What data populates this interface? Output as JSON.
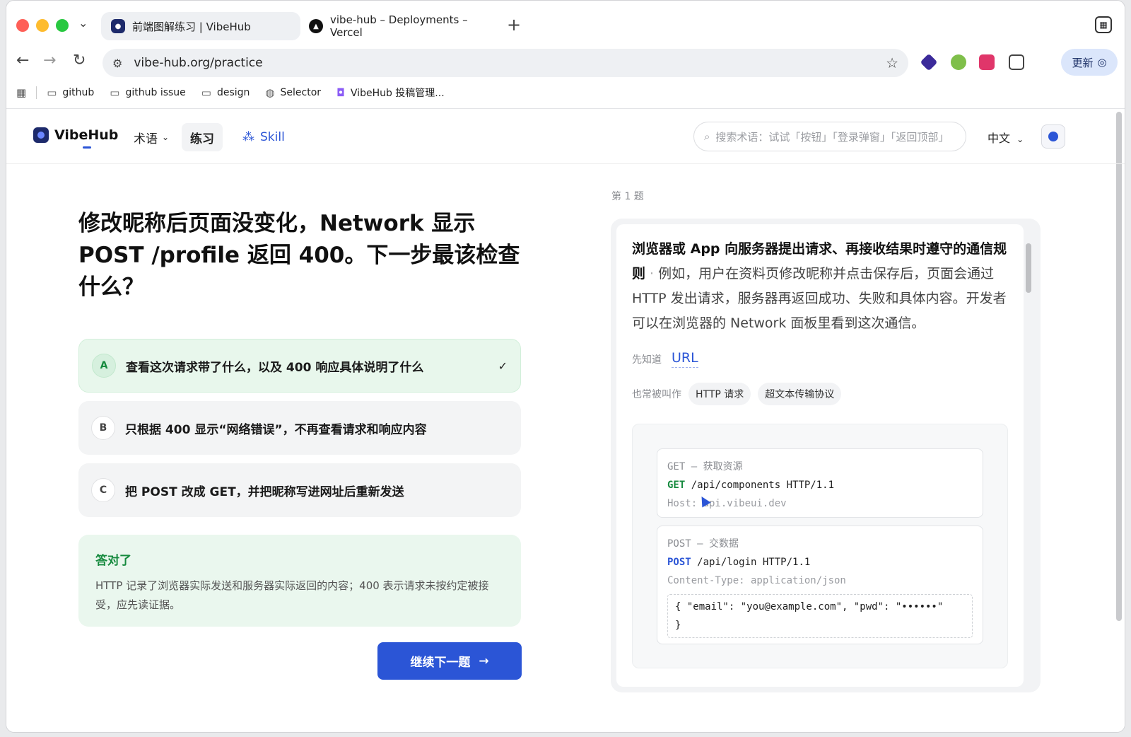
{
  "browser": {
    "tabs": [
      {
        "title": "前端图解练习 | VibeHub",
        "active": true
      },
      {
        "title": "vibe-hub – Deployments – Vercel",
        "active": false
      }
    ],
    "new_tab": "+",
    "url": "vibe-hub.org/practice",
    "update_label": "更新",
    "bookmarks": [
      {
        "label": "github",
        "icon": "folder-icon"
      },
      {
        "label": "github issue",
        "icon": "folder-icon"
      },
      {
        "label": "design",
        "icon": "folder-icon"
      },
      {
        "label": "Selector",
        "icon": "globe-icon"
      },
      {
        "label": "VibeHub 投稿管理...",
        "icon": "app-icon"
      }
    ]
  },
  "site": {
    "brand": "VibeHub",
    "nav": {
      "terms": "术语",
      "practice": "练习",
      "skill": "Skill"
    },
    "search_placeholder": "搜索术语：试试「按钮」「登录弹窗」「返回顶部」",
    "language": "中文",
    "accent_color": "#2b55d6",
    "success_color": "#168a3e"
  },
  "quiz": {
    "question": "修改昵称后页面没变化，Network 显示 POST /profile 返回 400。下一步最该检查什么？",
    "options": [
      {
        "letter": "A",
        "text": "查看这次请求带了什么，以及 400 响应具体说明了什么",
        "correct": true
      },
      {
        "letter": "B",
        "text": "只根据 400 显示“网络错误”，不再查看请求和响应内容",
        "correct": false
      },
      {
        "letter": "C",
        "text": "把 POST 改成 GET，并把昵称写进网址后重新发送",
        "correct": false
      }
    ],
    "feedback": {
      "title": "答对了",
      "text": "HTTP 记录了浏览器实际发送和服务器实际返回的内容；400 表示请求未按约定被接受，应先读证据。"
    },
    "next_label": "继续下一题"
  },
  "term_card": {
    "question_number": "第 1 题",
    "definition_strong": "浏览器或 App 向服务器提出请求、再接收结果时遵守的通信规则",
    "definition_rest": "例如，用户在资料页修改昵称并点击保存后，页面会通过 HTTP 发出请求，服务器再返回成功、失败和具体内容。开发者可以在浏览器的 Network 面板里看到这次通信。",
    "prereq_label": "先知道",
    "prereq_link": "URL",
    "aka_label": "也常被叫作",
    "aka_chips": [
      "HTTP 请求",
      "超文本传输协议"
    ],
    "examples": [
      {
        "title": "GET — 获取资源",
        "method": "GET",
        "request_line": "/api/components HTTP/1.1",
        "header": "Host: api.vibeui.dev"
      },
      {
        "title": "POST — 交数据",
        "method": "POST",
        "request_line": "/api/login HTTP/1.1",
        "header": "Content-Type: application/json",
        "body_line1": "{ \"email\": \"you@example.com\", \"pwd\": \"••••••\"",
        "body_line2": "}"
      }
    ]
  }
}
